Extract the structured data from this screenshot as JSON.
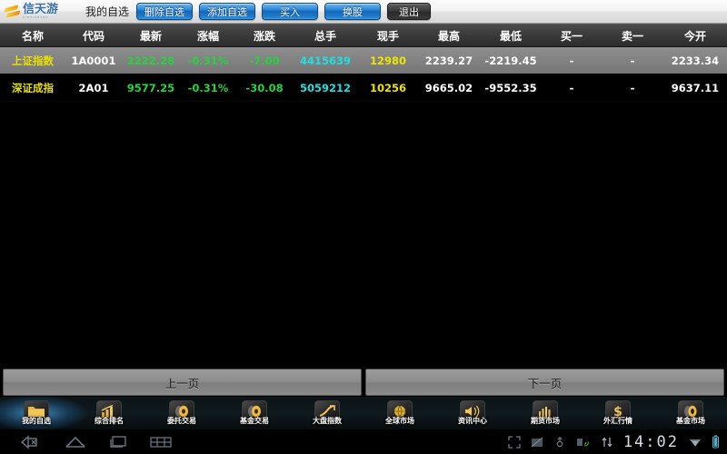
{
  "app": {
    "logo_text": "信天游",
    "logo_sub": "XINTIANYOU",
    "nav_label": "我的自选"
  },
  "toolbar": {
    "buttons": [
      {
        "label": "删除自选",
        "style": "blue"
      },
      {
        "label": "添加自选",
        "style": "blue"
      },
      {
        "label": "买入",
        "style": "blue"
      },
      {
        "label": "换股",
        "style": "blue"
      },
      {
        "label": "退出",
        "style": "dark"
      }
    ]
  },
  "table": {
    "columns": [
      "名称",
      "代码",
      "最新",
      "涨幅",
      "涨跌",
      "总手",
      "现手",
      "最高",
      "最低",
      "买一",
      "卖一",
      "今开"
    ],
    "rows": [
      {
        "selected": true,
        "name": "上证指数",
        "code": "1A0001",
        "last": "2222.28",
        "change_pct": "-0.31%",
        "change": "-7.00",
        "volume": "4415639",
        "current_volume": "12980",
        "high": "2239.27",
        "low": "-2219.45",
        "bid1": "-",
        "ask1": "-",
        "open": "2233.34"
      },
      {
        "selected": false,
        "name": "深证成指",
        "code": "2A01",
        "last": "9577.25",
        "change_pct": "-0.31%",
        "change": "-30.08",
        "volume": "5059212",
        "current_volume": "10256",
        "high": "9665.02",
        "low": "-9552.35",
        "bid1": "-",
        "ask1": "-",
        "open": "9637.11"
      }
    ]
  },
  "pager": {
    "prev_label": "上一页",
    "next_label": "下一页"
  },
  "dock": {
    "items": [
      {
        "label": "我的自选",
        "icon": "folder-icon",
        "active": true
      },
      {
        "label": "综合排名",
        "icon": "ranking-chart-icon",
        "active": false
      },
      {
        "label": "委托交易",
        "icon": "coin-icon",
        "active": false
      },
      {
        "label": "基金交易",
        "icon": "coin-icon",
        "active": false
      },
      {
        "label": "大盘指数",
        "icon": "trend-up-icon",
        "active": false
      },
      {
        "label": "全球市场",
        "icon": "globe-icon",
        "active": false
      },
      {
        "label": "资讯中心",
        "icon": "speaker-icon",
        "active": false
      },
      {
        "label": "期货市场",
        "icon": "bar-chart-icon",
        "active": false
      },
      {
        "label": "外汇行情",
        "icon": "dollar-icon",
        "active": false
      },
      {
        "label": "基金市场",
        "icon": "coin-stack-icon",
        "active": false
      }
    ]
  },
  "statusbar": {
    "time": "14:02",
    "left_icons": [
      "back-icon",
      "home-icon",
      "recent-apps-icon",
      "app-grid-icon"
    ],
    "right_icons": [
      "fullscreen-icon",
      "screenshot-icon",
      "usb-icon",
      "cast-icon",
      "data-transfer-icon",
      "wifi-icon",
      "battery-icon"
    ]
  },
  "colors": {
    "up": "#24d43c",
    "volume": "#1ee0e0",
    "current_volume": "#ece600",
    "name": "#e8e000",
    "accent_blue": "#2f8ada"
  }
}
